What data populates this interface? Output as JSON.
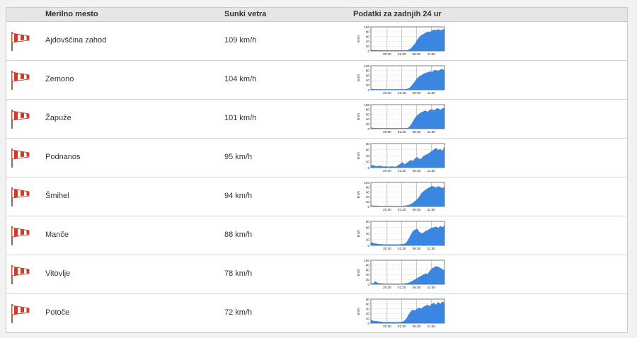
{
  "table": {
    "headers": {
      "location": "Merilno mesto",
      "gust": "Sunki vetra",
      "data": "Podatki za zadnjih 24 ur"
    },
    "icons": {
      "windsock": "windsock-icon"
    },
    "colors": {
      "series": "#3a86e0",
      "sock_red": "#d43a2a",
      "sock_white": "#ffffff"
    }
  },
  "rows": [
    {
      "name": "Ajdovščina zahod",
      "gust": "109 km/h"
    },
    {
      "name": "Zemono",
      "gust": "104 km/h"
    },
    {
      "name": "Žapuže",
      "gust": "101 km/h"
    },
    {
      "name": "Podnanos",
      "gust": "95 km/h"
    },
    {
      "name": "Šmihel",
      "gust": "94 km/h"
    },
    {
      "name": "Manče",
      "gust": "88 km/h"
    },
    {
      "name": "Vitovlje",
      "gust": "78 km/h"
    },
    {
      "name": "Potoče",
      "gust": "72 km/h"
    }
  ],
  "chart_data": [
    {
      "type": "area",
      "ylabel": "km/h",
      "xticks": [
        "20:30",
        "01:30",
        "06:30",
        "11:30"
      ],
      "yticks": [
        0,
        20,
        40,
        60,
        80,
        100
      ],
      "ylim": [
        0,
        100
      ],
      "values": [
        4,
        3,
        3,
        2,
        2,
        2,
        2,
        2,
        2,
        2,
        2,
        2,
        2,
        2,
        2,
        2,
        2,
        2,
        5,
        10,
        20,
        30,
        45,
        58,
        65,
        70,
        75,
        80,
        78,
        84,
        88,
        86,
        90,
        85,
        88,
        92
      ]
    },
    {
      "type": "area",
      "ylabel": "km/h",
      "xticks": [
        "20:30",
        "01:30",
        "06:30",
        "11:30"
      ],
      "yticks": [
        0,
        20,
        40,
        60,
        80,
        100
      ],
      "ylim": [
        0,
        100
      ],
      "values": [
        3,
        3,
        2,
        2,
        2,
        2,
        2,
        2,
        2,
        2,
        2,
        2,
        2,
        2,
        2,
        2,
        2,
        3,
        6,
        12,
        25,
        35,
        48,
        55,
        60,
        66,
        70,
        72,
        76,
        74,
        80,
        82,
        78,
        84,
        86,
        80
      ]
    },
    {
      "type": "area",
      "ylabel": "km/h",
      "xticks": [
        "20:30",
        "01:30",
        "06:30",
        "11:30"
      ],
      "yticks": [
        0,
        20,
        40,
        60,
        80,
        100
      ],
      "ylim": [
        0,
        100
      ],
      "values": [
        4,
        3,
        3,
        2,
        2,
        2,
        2,
        2,
        2,
        2,
        2,
        2,
        2,
        2,
        2,
        2,
        2,
        2,
        5,
        15,
        30,
        45,
        55,
        62,
        68,
        72,
        75,
        70,
        78,
        80,
        76,
        82,
        85,
        78,
        84,
        88
      ]
    },
    {
      "type": "area",
      "ylabel": "km/h",
      "xticks": [
        "20:30",
        "01:30",
        "06:30",
        "11:30"
      ],
      "yticks": [
        0,
        20,
        40,
        60,
        80
      ],
      "ylim": [
        0,
        80
      ],
      "values": [
        6,
        8,
        5,
        4,
        6,
        5,
        3,
        4,
        3,
        3,
        4,
        3,
        3,
        8,
        12,
        18,
        10,
        15,
        20,
        25,
        22,
        30,
        35,
        28,
        30,
        38,
        42,
        45,
        50,
        55,
        60,
        65,
        58,
        62,
        55,
        70
      ]
    },
    {
      "type": "area",
      "ylabel": "km/h",
      "xticks": [
        "20:30",
        "01:30",
        "06:30",
        "11:30"
      ],
      "yticks": [
        0,
        20,
        40,
        60,
        80,
        100
      ],
      "ylim": [
        0,
        100
      ],
      "values": [
        4,
        3,
        3,
        3,
        2,
        2,
        2,
        2,
        2,
        2,
        2,
        2,
        2,
        2,
        2,
        2,
        3,
        4,
        6,
        10,
        15,
        22,
        30,
        40,
        55,
        62,
        70,
        75,
        80,
        85,
        82,
        78,
        84,
        80,
        76,
        82
      ]
    },
    {
      "type": "area",
      "ylabel": "km/h",
      "xticks": [
        "20:30",
        "01:30",
        "06:30",
        "11:30"
      ],
      "yticks": [
        0,
        20,
        40,
        60,
        80
      ],
      "ylim": [
        0,
        80
      ],
      "values": [
        10,
        8,
        6,
        5,
        4,
        4,
        3,
        3,
        3,
        3,
        3,
        3,
        3,
        3,
        3,
        4,
        5,
        10,
        22,
        35,
        48,
        52,
        55,
        45,
        40,
        42,
        48,
        50,
        55,
        58,
        60,
        62,
        58,
        64,
        60,
        66
      ]
    },
    {
      "type": "area",
      "ylabel": "km/h",
      "xticks": [
        "20:30",
        "01:30",
        "06:30",
        "11:30"
      ],
      "yticks": [
        0,
        20,
        40,
        60,
        80,
        100
      ],
      "ylim": [
        0,
        100
      ],
      "values": [
        4,
        3,
        12,
        6,
        4,
        3,
        3,
        2,
        2,
        2,
        2,
        2,
        2,
        2,
        2,
        2,
        3,
        4,
        6,
        10,
        15,
        20,
        25,
        30,
        35,
        40,
        45,
        42,
        55,
        65,
        70,
        75,
        72,
        68,
        62,
        58
      ]
    },
    {
      "type": "area",
      "ylabel": "km/h",
      "xticks": [
        "20:30",
        "01:30",
        "06:30",
        "11:30"
      ],
      "yticks": [
        0,
        10,
        20,
        30,
        40,
        50
      ],
      "ylim": [
        0,
        50
      ],
      "values": [
        6,
        5,
        4,
        4,
        3,
        3,
        2,
        2,
        2,
        2,
        2,
        2,
        2,
        2,
        2,
        3,
        5,
        10,
        18,
        24,
        28,
        26,
        30,
        32,
        30,
        34,
        36,
        38,
        35,
        40,
        42,
        38,
        44,
        40,
        45,
        42
      ]
    }
  ]
}
